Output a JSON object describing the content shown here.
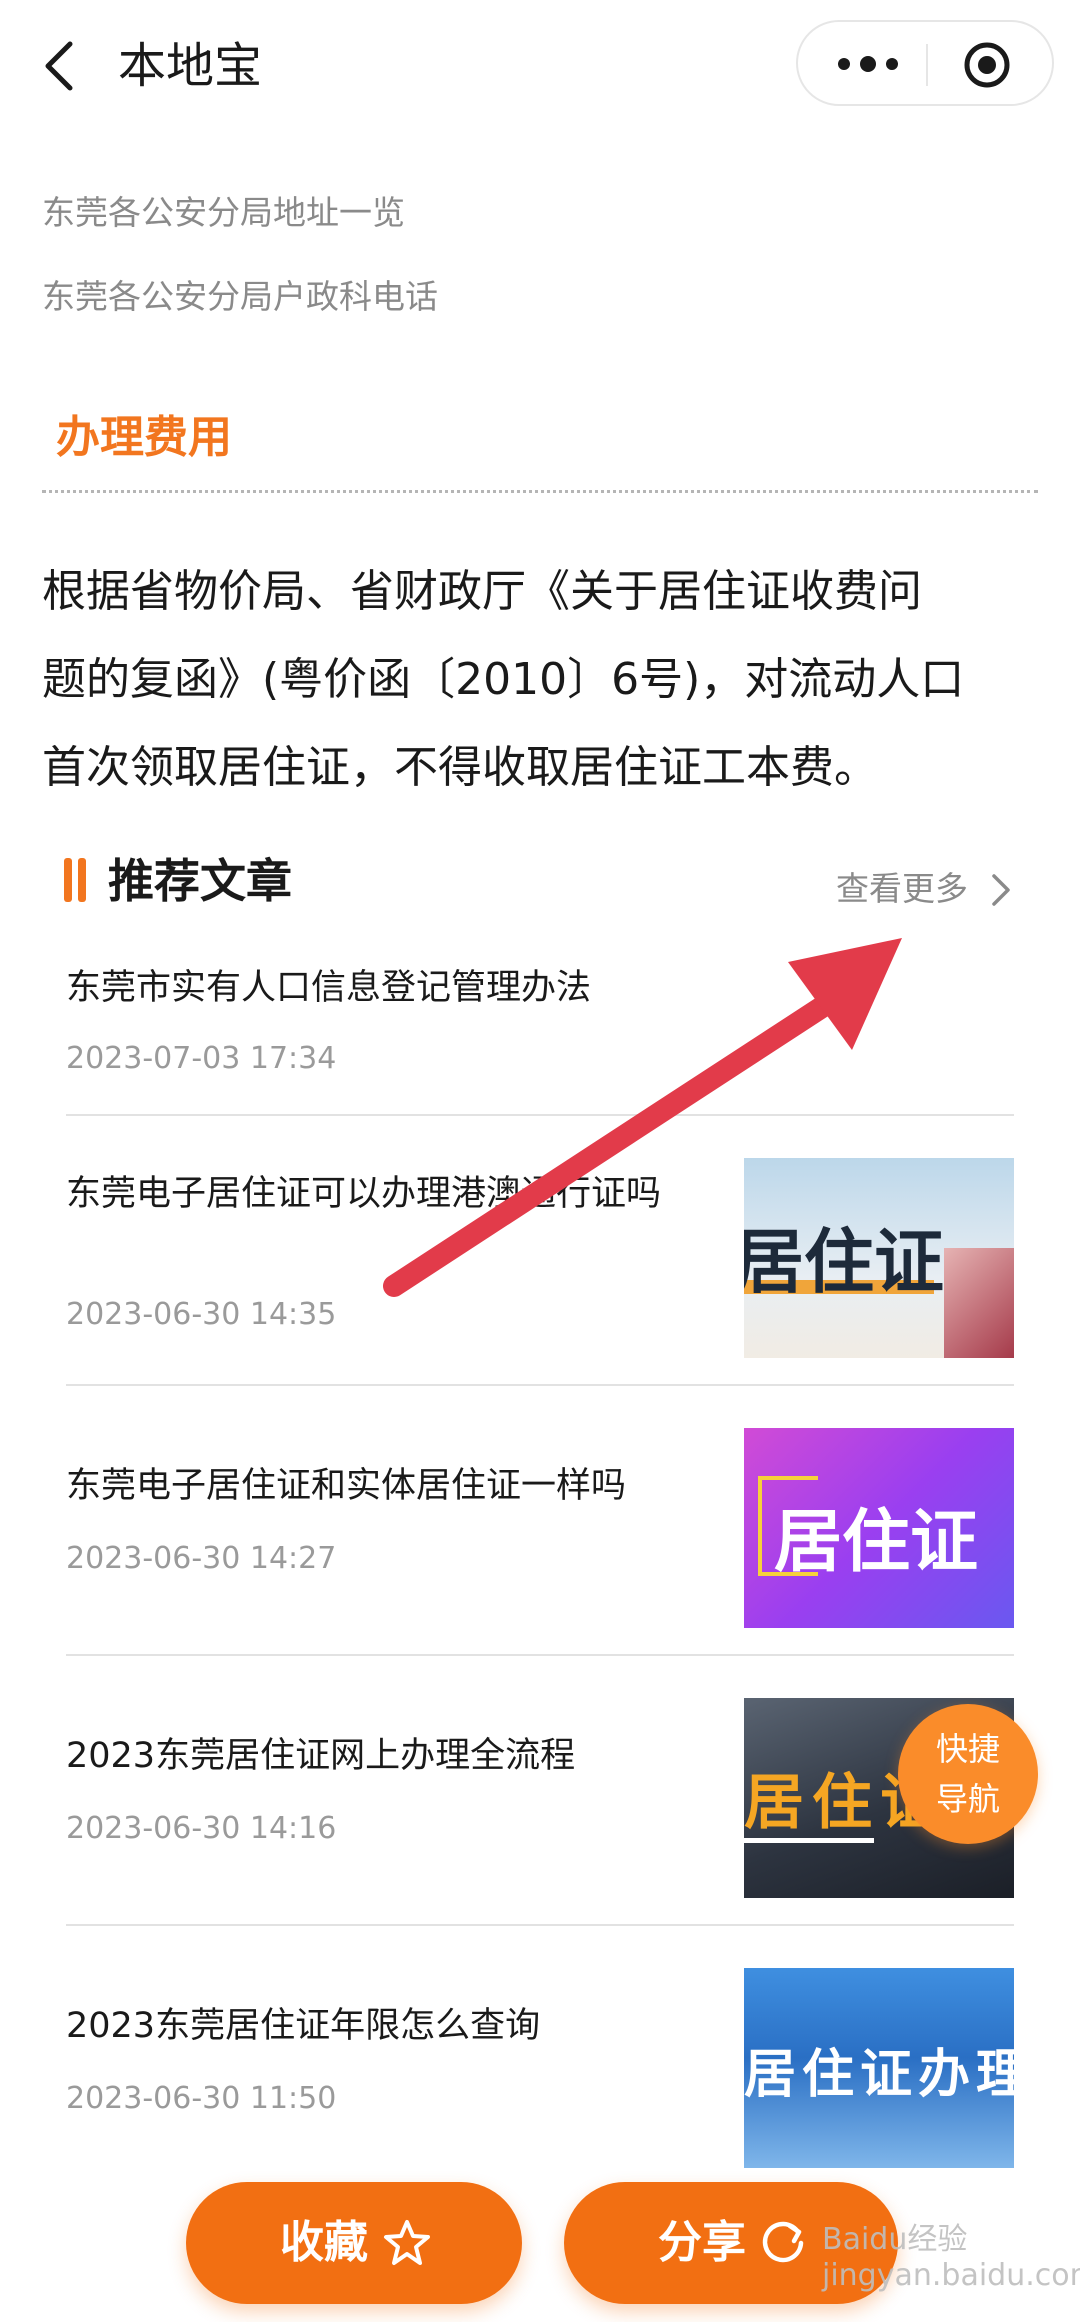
{
  "header": {
    "title": "本地宝"
  },
  "links": [
    "东莞各公安分局地址一览",
    "东莞各公安分局户政科电话"
  ],
  "fee_section": {
    "title": "办理费用",
    "body_lines": [
      "根据省物价局、省财政厅《关于居住证收费问",
      "题的复函》(粤价函〔2010〕6号)，对流动人口",
      "首次领取居住证，不得收取居住证工本费。"
    ]
  },
  "recommended": {
    "title": "推荐文章",
    "more_label": "查看更多",
    "articles": [
      {
        "title": "东莞市实有人口信息登记管理办法",
        "date": "2023-07-03 17:34"
      },
      {
        "title": "东莞电子居住证可以办理港澳通行证吗",
        "date": "2023-06-30 14:35",
        "thumb_text": "居住证"
      },
      {
        "title": "东莞电子居住证和实体居住证一样吗",
        "date": "2023-06-30 14:27",
        "thumb_text": "居住证"
      },
      {
        "title": "2023东莞居住证网上办理全流程",
        "date": "2023-06-30 14:16",
        "thumb_text": "居住证"
      },
      {
        "title": "2023东莞居住证年限怎么查询",
        "date": "2023-06-30 11:50",
        "thumb_text": "居住证办理"
      }
    ]
  },
  "quick_nav": {
    "line1": "快捷",
    "line2": "导航"
  },
  "bottom_bar": {
    "favorite_label": "收藏",
    "share_label": "分享"
  },
  "watermark": "Baidu经验 jingyan.baidu.com",
  "colors": {
    "accent": "#f2761f",
    "button": "#f26f12",
    "annotation_arrow": "#e23b4a"
  },
  "icons": [
    "back-arrow-icon",
    "more-dots-icon",
    "target-icon",
    "chevron-right-icon",
    "star-icon",
    "share-icon"
  ]
}
